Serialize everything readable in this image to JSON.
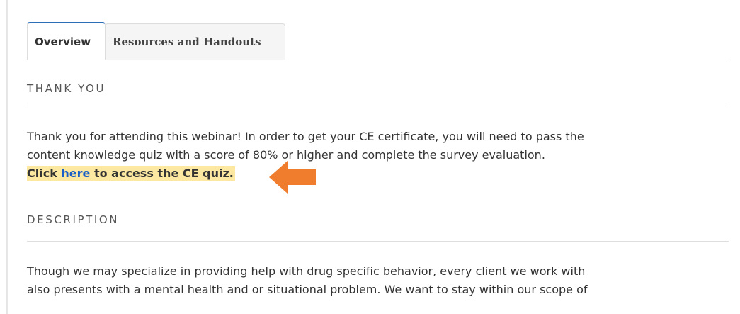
{
  "tabs": [
    {
      "label": "Overview",
      "active": true
    },
    {
      "label": "Resources and Handouts",
      "active": false
    }
  ],
  "thank_you": {
    "heading": "THANK YOU",
    "body_line1": "Thank you for attending this webinar! In order to get your CE certificate, you will need to pass the",
    "body_line2": "content knowledge quiz with a score of 80% or higher and complete the survey evaluation.",
    "cta_prefix": "Click ",
    "cta_link": "here",
    "cta_suffix": " to access the CE quiz."
  },
  "description": {
    "heading": "DESCRIPTION",
    "body_line1": "Though we may specialize in providing help with drug specific behavior, every client we work with",
    "body_line2": "also presents with a mental health and or situational problem. We want to stay within our scope of"
  },
  "colors": {
    "accent_tab": "#2c6fb7",
    "link": "#1a5fc7",
    "highlight": "#fce8a1",
    "arrow": "#ef7d2d"
  },
  "icons": {
    "pointer": "arrow-left-icon"
  }
}
